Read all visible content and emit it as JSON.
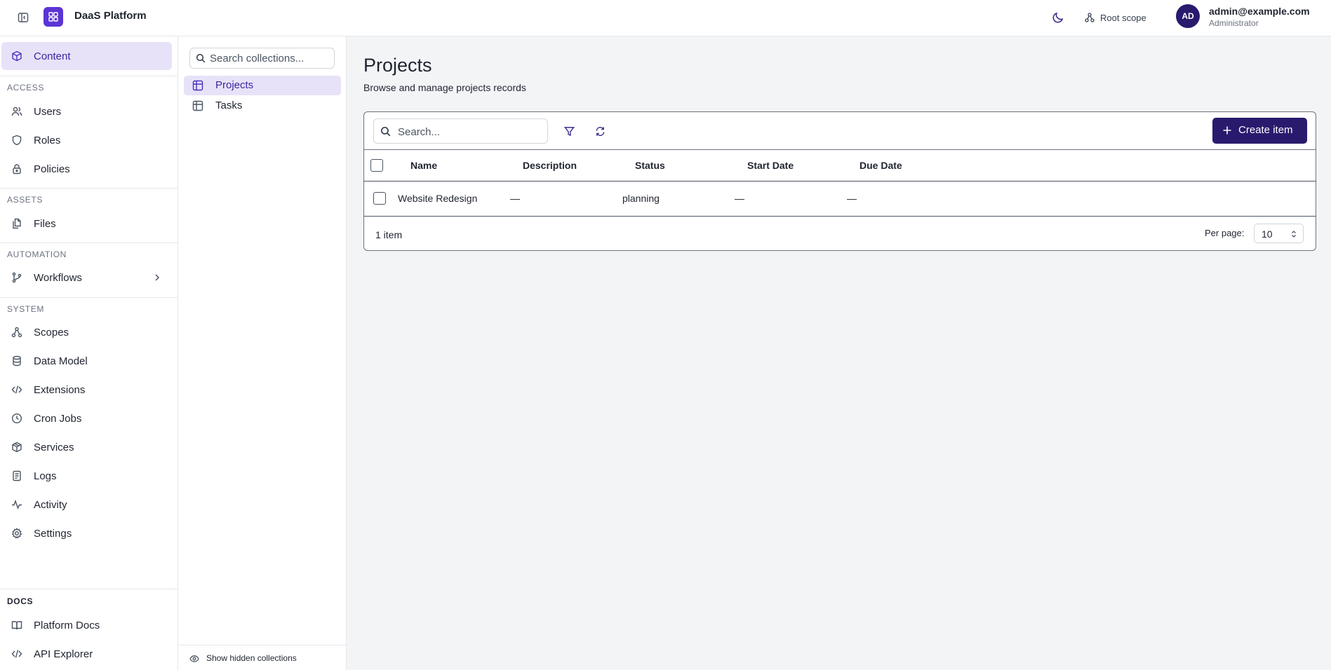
{
  "app": {
    "title": "DaaS Platform"
  },
  "header": {
    "scope_label": "Root scope",
    "user_initials": "AD",
    "user_email": "admin@example.com",
    "user_role": "Administrator"
  },
  "sidebar": {
    "content_label": "Content",
    "sections": {
      "access": "ACCESS",
      "assets": "ASSETS",
      "automation": "AUTOMATION",
      "system": "SYSTEM",
      "docs": "DOCS"
    },
    "items": {
      "users": "Users",
      "roles": "Roles",
      "policies": "Policies",
      "files": "Files",
      "workflows": "Workflows",
      "scopes": "Scopes",
      "data_model": "Data Model",
      "extensions": "Extensions",
      "cron_jobs": "Cron Jobs",
      "services": "Services",
      "logs": "Logs",
      "activity": "Activity",
      "settings": "Settings",
      "platform_docs": "Platform Docs",
      "api_explorer": "API Explorer"
    }
  },
  "collections": {
    "search_placeholder": "Search collections...",
    "items": [
      "Projects",
      "Tasks"
    ],
    "active": "Projects",
    "footer_label": "Show hidden collections"
  },
  "main": {
    "title": "Projects",
    "subtitle": "Browse and manage projects records",
    "search_placeholder": "Search...",
    "create_label": "Create item",
    "columns": [
      "Name",
      "Description",
      "Status",
      "Start Date",
      "Due Date"
    ],
    "rows": [
      {
        "name": "Website Redesign",
        "description": "—",
        "status": "planning",
        "start_date": "—",
        "due_date": "—"
      }
    ],
    "count_label": "1 item",
    "per_page_label": "Per page:",
    "per_page_value": "10"
  },
  "colors": {
    "accent": "#5b34d6",
    "primary_button": "#2a1a6e",
    "active_bg": "#e7e2f8"
  }
}
